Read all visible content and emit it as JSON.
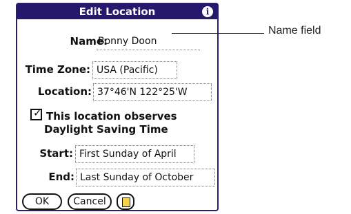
{
  "dialog": {
    "title": "Edit Location",
    "info_icon": "info-icon"
  },
  "form": {
    "name_label": "Name:",
    "name_value": "Bonny Doon",
    "timezone_label": "Time Zone:",
    "timezone_value": "USA (Pacific)",
    "location_label": "Location:",
    "location_value": "37°46'N 122°25'W",
    "dst_line1": "This location observes",
    "dst_line2": "Daylight Saving Time",
    "dst_checked": true,
    "start_label": "Start:",
    "start_value": "First Sunday of April",
    "end_label": "End:",
    "end_value": "Last Sunday of October"
  },
  "buttons": {
    "ok": "OK",
    "cancel": "Cancel",
    "note_icon": "note-icon"
  },
  "callout": {
    "label": "Name field"
  },
  "colors": {
    "titlebar": "#24196b",
    "note": "#f3d44a"
  }
}
